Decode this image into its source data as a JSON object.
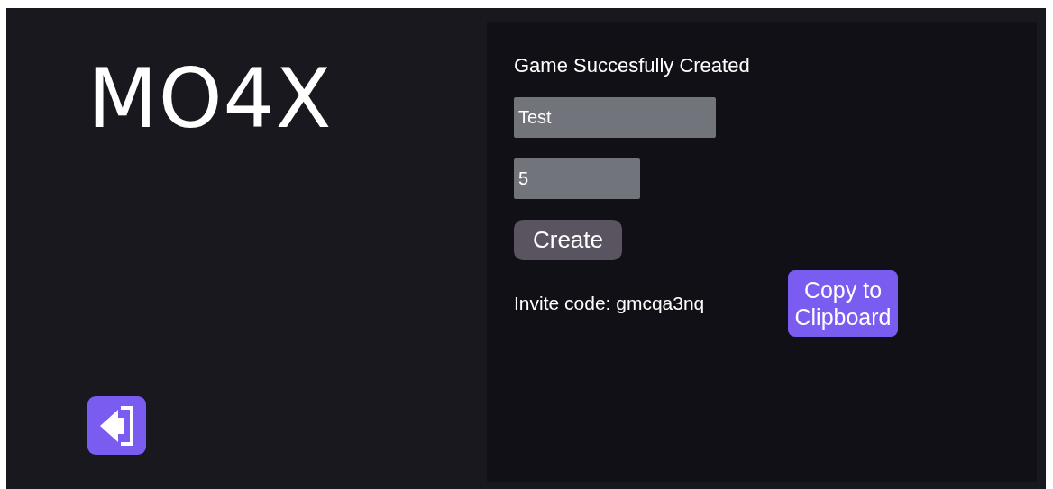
{
  "app": {
    "title": "MO4X"
  },
  "back_button": {
    "kind": "exit"
  },
  "panel": {
    "heading": "Game Succesfully Created",
    "fields": [
      {
        "value": "Test",
        "kind": "wide"
      },
      {
        "value": "5",
        "kind": "narrow"
      }
    ],
    "create_button": {
      "label": "Create"
    },
    "invite_text": "Invite code: gmcqa3nq",
    "copy_button": {
      "label": "Copy to Clipboard"
    }
  }
}
